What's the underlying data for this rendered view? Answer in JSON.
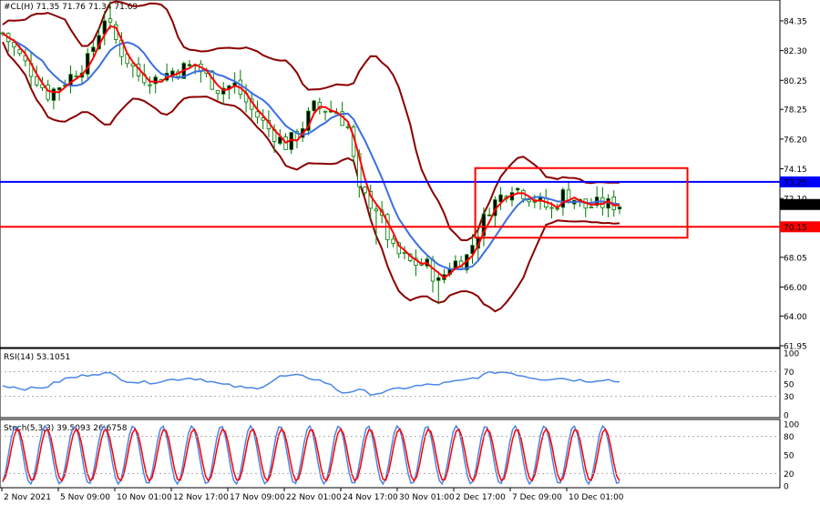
{
  "header": {
    "symbol": "#CL(H)",
    "ohlc": "71.35 71.76 71.34 71.69"
  },
  "colors": {
    "candle": "#007a00",
    "bb": "#8b0000",
    "ma_fast": "#ff0000",
    "ma_slow": "#3a6fe0",
    "level_blue": "#0000ff",
    "level_red": "#ff0000",
    "box": "#ff0000",
    "rsi": "#4a86e8",
    "stoch_main": "#4a86e8",
    "stoch_signal": "#ff0000"
  },
  "chart_data": [
    {
      "type": "candlestick",
      "title": "#CL(H) 71.35 71.76 71.34 71.69",
      "y_range": [
        61.95,
        85.6
      ],
      "y_ticks": [
        "84.35",
        "82.30",
        "80.25",
        "78.25",
        "76.20",
        "74.15",
        "72.10",
        "70.15",
        "68.05",
        "66.00",
        "64.00",
        "61.95"
      ],
      "x_ticks": [
        "2 Nov 2021",
        "5 Nov 09:00",
        "10 Nov 01:00",
        "12 Nov 17:00",
        "17 Nov 09:00",
        "22 Nov 01:00",
        "24 Nov 17:00",
        "30 Nov 01:00",
        "2 Dec 17:00",
        "7 Dec 09:00",
        "10 Dec 01:00"
      ],
      "price_path": [
        [
          0,
          83.5
        ],
        [
          4,
          81.4
        ],
        [
          8,
          79.3
        ],
        [
          11,
          80.2
        ],
        [
          15,
          81.6
        ],
        [
          18,
          84.6
        ],
        [
          21,
          82.2
        ],
        [
          24,
          80.6
        ],
        [
          27,
          80.3
        ],
        [
          30,
          80.9
        ],
        [
          34,
          81.3
        ],
        [
          38,
          79.7
        ],
        [
          41,
          79.9
        ],
        [
          44,
          78.2
        ],
        [
          47,
          76.9
        ],
        [
          50,
          75.8
        ],
        [
          52,
          76.5
        ],
        [
          55,
          78.4
        ],
        [
          59,
          78.1
        ],
        [
          61,
          77.0
        ],
        [
          63,
          72.5
        ],
        [
          66,
          71.5
        ],
        [
          69,
          68.5
        ],
        [
          72,
          67.7
        ],
        [
          75,
          67.5
        ],
        [
          77,
          66.3
        ],
        [
          79,
          67.5
        ],
        [
          82,
          68.1
        ],
        [
          86,
          71.5
        ],
        [
          90,
          73.0
        ],
        [
          93,
          72.3
        ],
        [
          95,
          71.8
        ],
        [
          97,
          71.3
        ],
        [
          99,
          72.4
        ],
        [
          101,
          72.1
        ],
        [
          103,
          71.5
        ],
        [
          105,
          71.69
        ]
      ],
      "price_levels": [
        {
          "label": "73.25",
          "value": 73.25,
          "color": "#0000ff"
        },
        {
          "label": "70.15",
          "value": 70.15,
          "color": "#ff0000"
        }
      ],
      "current_price_label": "71.69",
      "consolidation_box": {
        "from_bar": 83.5,
        "to_bar": 121,
        "top": 74.2,
        "bottom": 69.4
      }
    },
    {
      "type": "line",
      "title": "RSI(14) 53.1051",
      "y_range": [
        0,
        100
      ],
      "y_ticks": [
        "100",
        "70",
        "50",
        "30",
        "0"
      ],
      "series": [
        {
          "values": [
            48,
            44,
            42,
            47,
            58,
            62,
            68,
            66,
            56,
            52,
            54,
            57,
            60,
            58,
            50,
            46,
            42,
            48,
            62,
            63,
            60,
            52,
            36,
            40,
            34,
            38,
            44,
            47,
            49,
            52,
            56,
            63,
            70,
            68,
            62,
            58,
            60,
            57,
            55,
            58,
            53.1
          ]
        }
      ]
    },
    {
      "type": "line",
      "title": "Stoch(5,3,3) 39.5093 26.6758",
      "y_range": [
        0,
        100
      ],
      "y_ticks": [
        "100",
        "80",
        "50",
        "20",
        "0"
      ],
      "series": [
        {
          "values": []
        },
        {
          "values": []
        }
      ],
      "stoch_shape": {
        "cycles": 21,
        "main_last": 39.5093,
        "signal_last": 26.6758
      }
    }
  ]
}
